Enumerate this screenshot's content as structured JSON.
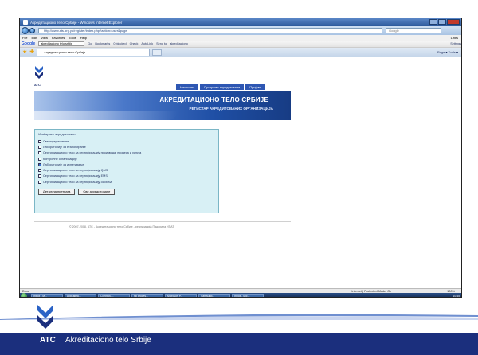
{
  "browser": {
    "window_title": "Акредитационо тело Србије - Windows Internet Explorer",
    "address": "http://www.ats.org.yu/register/index.php?action=user&page",
    "search_placeholder": "Google",
    "menu": [
      "File",
      "Edit",
      "View",
      "Favorites",
      "Tools",
      "Help"
    ],
    "links_label": "Links",
    "google_toolbar": {
      "logo": "Google",
      "query": "akreditaciono telo srbije",
      "items": [
        "Go",
        "Bookmarks",
        "0 blocked",
        "Check",
        "AutoLink",
        "Send to",
        "akreditaciono"
      ],
      "settings": "Settings"
    },
    "tab_label": "Акредитационо тело Србије",
    "commands": "Page ▾   Tools ▾"
  },
  "site": {
    "logo_text": "ATC",
    "nav_tabs": [
      "Насловна",
      "Програми акредитовани",
      "Пријава"
    ],
    "banner_title": "АКРЕДИТАЦИОНО ТЕЛО СРБИЈЕ",
    "banner_subtitle": "РЕГИСТАР АКРЕДИТОВАНИХ ОРГАНИЗАЦИЈА",
    "filter": {
      "heading": "Изаберите акредитовано",
      "options": [
        {
          "label": "Све акредитоване",
          "checked": false
        },
        {
          "label": "Лабораторије за еталонирање",
          "checked": false
        },
        {
          "label": "Сертификационо тело за сертификацију производа, процеса и услуга",
          "checked": false
        },
        {
          "label": "Контролне организације",
          "checked": false
        },
        {
          "label": "Лабораторије за испитивање",
          "checked": true
        },
        {
          "label": "Сертификационо тело за сертификацију QMS",
          "checked": false
        },
        {
          "label": "Сертификационо тело за сертификацију EMS",
          "checked": false
        },
        {
          "label": "Сертификационо тело за сертификацију особља",
          "checked": false
        }
      ],
      "search_button": "Детаљна претрага",
      "all_button": "Све акредитоване"
    },
    "footer": "© 2007-2008, АТС - Акредитационо тело Србије - реализација Падорина ИПАТ"
  },
  "status_bar": {
    "left": "Done",
    "zone": "Internet | Protected Mode: On",
    "zoom": "100%"
  },
  "taskbar": {
    "tasks": [
      "Inbox - M...",
      "Акредита...",
      "Connect-...",
      "Nil proces...",
      "Microsoft P...",
      "Samsung...",
      "Inbox - Mic..."
    ],
    "clock": "10:45"
  },
  "slide": {
    "atc": "ATC",
    "org_name": "Akreditaciono telo Srbije"
  },
  "colors": {
    "brand_blue": "#1b2f7d",
    "nav_blue": "#2e57b3",
    "filter_bg": "#d8f0f5"
  }
}
